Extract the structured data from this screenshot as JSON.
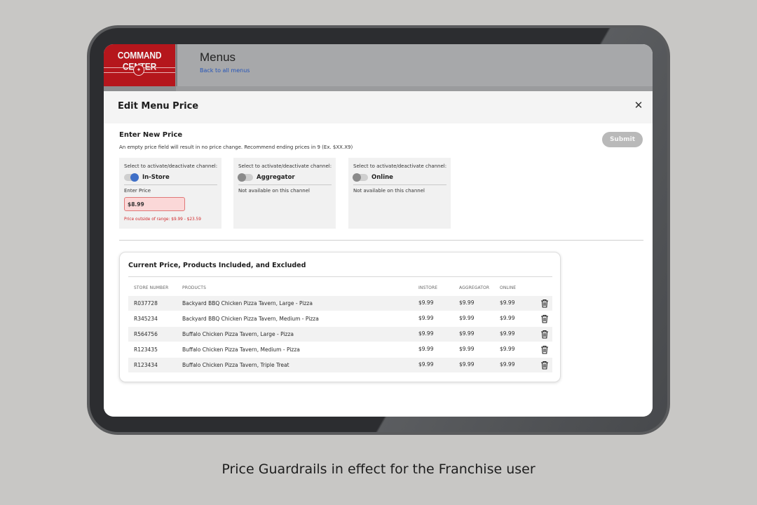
{
  "app": {
    "brand": "COMMAND CENTER",
    "page_title": "Menus",
    "back_link": "Back to all menus"
  },
  "modal": {
    "title": "Edit Menu Price",
    "close_icon": "close-icon",
    "section_title": "Enter New Price",
    "section_note": "An empty price field will result in no price change. Recommend ending prices in 9 (Ex. $XX.X9)",
    "submit_label": "Submit"
  },
  "channels": [
    {
      "caption": "Select to activate/deactivate channel:",
      "name": "In-Store",
      "active": true,
      "price_label": "Enter Price",
      "price_value": "$8.99",
      "error": "Price outside of range: $9.99 - $23.59"
    },
    {
      "caption": "Select to activate/deactivate channel:",
      "name": "Aggregator",
      "active": false,
      "status": "Not available on this channel"
    },
    {
      "caption": "Select to activate/deactivate channel:",
      "name": "Online",
      "active": false,
      "status": "Not available on this channel"
    }
  ],
  "products": {
    "title": "Current Price, Products Included, and Excluded",
    "columns": [
      "STORE NUMBER",
      "PRODUCTS",
      "INSTORE",
      "AGGREGATOR",
      "ONLINE"
    ],
    "rows": [
      {
        "store": "R037728",
        "product": "Backyard BBQ Chicken Pizza Tavern, Large - Pizza",
        "instore": "$9.99",
        "aggregator": "$9.99",
        "online": "$9.99"
      },
      {
        "store": "R345234",
        "product": "Backyard BBQ Chicken Pizza Tavern, Medium - Pizza",
        "instore": "$9.99",
        "aggregator": "$9.99",
        "online": "$9.99"
      },
      {
        "store": "R564756",
        "product": "Buffalo Chicken Pizza Tavern, Large - Pizza",
        "instore": "$9.99",
        "aggregator": "$9.99",
        "online": "$9.99"
      },
      {
        "store": "R123435",
        "product": "Buffalo Chicken Pizza Tavern, Medium - Pizza",
        "instore": "$9.99",
        "aggregator": "$9.99",
        "online": "$9.99"
      },
      {
        "store": "R123434",
        "product": "Buffalo Chicken Pizza Tavern, Triple Treat",
        "instore": "$9.99",
        "aggregator": "$9.99",
        "online": "$9.99"
      }
    ],
    "row_action_icon": "trash-icon"
  },
  "caption": "Price Guardrails in effect for the Franchise user",
  "colors": {
    "brand_red": "#b5161c",
    "toggle_on": "#3f6fc7",
    "error_red": "#d0282b",
    "error_fill": "#fbd8d8"
  }
}
